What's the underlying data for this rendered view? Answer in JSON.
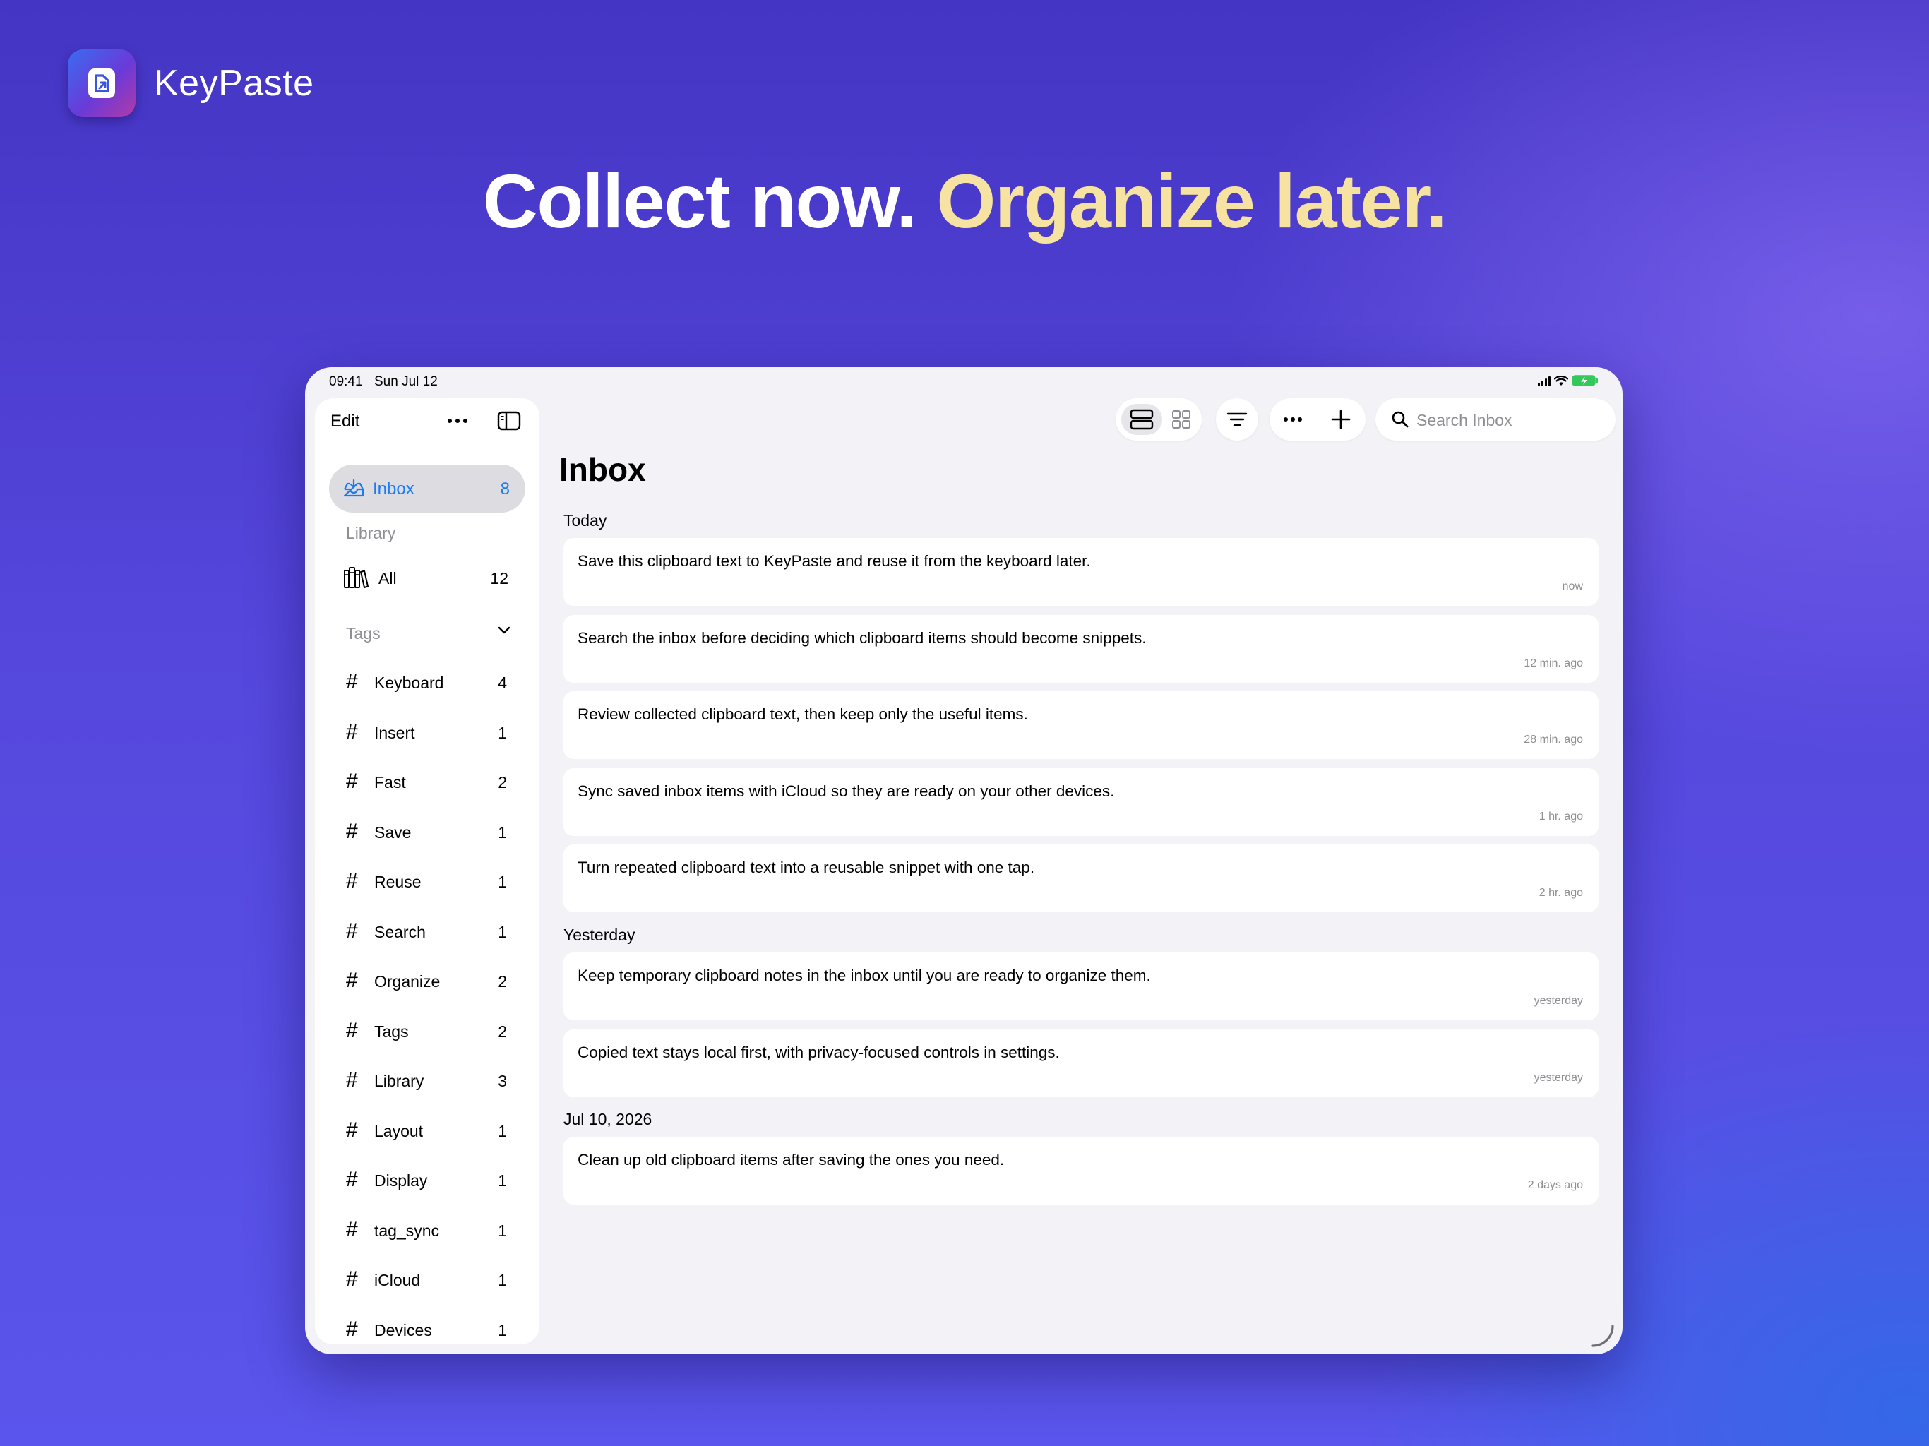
{
  "brand": {
    "name": "KeyPaste"
  },
  "headline": {
    "part1": "Collect now.",
    "part2": "Organize later."
  },
  "colors": {
    "accent": "#1a7cf5",
    "headline_highlight": "#f6e3a2",
    "background": "#5547dc"
  },
  "status_bar": {
    "time": "09:41",
    "date": "Sun Jul 12"
  },
  "sidebar": {
    "edit_label": "Edit",
    "more_icon": "ellipsis-icon",
    "toggle_icon": "sidebar-toggle-icon",
    "inbox": {
      "label": "Inbox",
      "count": "8",
      "icon": "inbox-tray-icon"
    },
    "library_title": "Library",
    "all": {
      "label": "All",
      "count": "12",
      "icon": "books-icon"
    },
    "tags_title": "Tags",
    "tags": [
      {
        "label": "Keyboard",
        "count": "4"
      },
      {
        "label": "Insert",
        "count": "1"
      },
      {
        "label": "Fast",
        "count": "2"
      },
      {
        "label": "Save",
        "count": "1"
      },
      {
        "label": "Reuse",
        "count": "1"
      },
      {
        "label": "Search",
        "count": "1"
      },
      {
        "label": "Organize",
        "count": "2"
      },
      {
        "label": "Tags",
        "count": "2"
      },
      {
        "label": "Library",
        "count": "3"
      },
      {
        "label": "Layout",
        "count": "1"
      },
      {
        "label": "Display",
        "count": "1"
      },
      {
        "label": "tag_sync",
        "count": "1"
      },
      {
        "label": "iCloud",
        "count": "1"
      },
      {
        "label": "Devices",
        "count": "1"
      }
    ]
  },
  "toolbar": {
    "view_modes": [
      "list-view-icon",
      "grid-view-icon"
    ],
    "active_view": "list",
    "filter_icon": "filter-icon",
    "more_icon": "ellipsis-icon",
    "add_icon": "plus-icon",
    "search_placeholder": "Search Inbox",
    "search_value": ""
  },
  "main": {
    "title": "Inbox",
    "groups": [
      {
        "label": "Today",
        "items": [
          {
            "text": "Save this clipboard text to KeyPaste and reuse it from the keyboard later.",
            "time": "now"
          },
          {
            "text": "Search the inbox before deciding which clipboard items should become snippets.",
            "time": "12 min. ago"
          },
          {
            "text": "Review collected clipboard text, then keep only the useful items.",
            "time": "28 min. ago"
          },
          {
            "text": "Sync saved inbox items with iCloud so they are ready on your other devices.",
            "time": "1 hr. ago"
          },
          {
            "text": "Turn repeated clipboard text into a reusable snippet with one tap.",
            "time": "2 hr. ago"
          }
        ]
      },
      {
        "label": "Yesterday",
        "items": [
          {
            "text": "Keep temporary clipboard notes in the inbox until you are ready to organize them.",
            "time": "yesterday"
          },
          {
            "text": "Copied text stays local first, with privacy-focused controls in settings.",
            "time": "yesterday"
          }
        ]
      },
      {
        "label": "Jul 10, 2026",
        "items": [
          {
            "text": "Clean up old clipboard items after saving the ones you need.",
            "time": "2 days ago"
          }
        ]
      }
    ]
  }
}
